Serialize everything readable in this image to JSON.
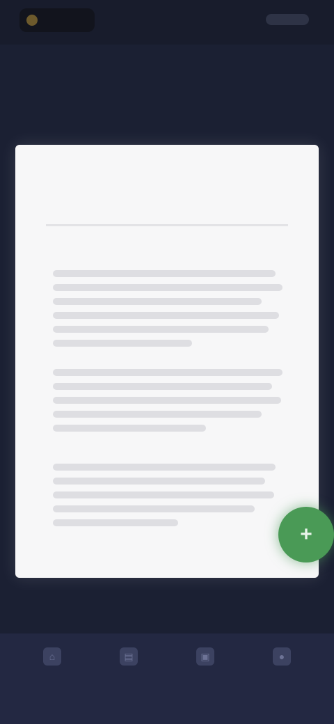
{
  "status_bar": {
    "brand_label": ""
  },
  "header": {
    "title": "",
    "subtitle": ""
  },
  "document": {
    "heading": "",
    "subheading": "",
    "sections": [
      {
        "label": "",
        "lines": 6
      },
      {
        "label": "",
        "lines": 5
      },
      {
        "label": "",
        "lines": 5
      }
    ]
  },
  "fab": {
    "icon": "plus-icon"
  },
  "footer": {
    "caption": ""
  },
  "tab_bar": {
    "items": [
      {
        "icon": "home-icon",
        "label": ""
      },
      {
        "icon": "document-icon",
        "label": ""
      },
      {
        "icon": "scan-icon",
        "label": ""
      },
      {
        "icon": "profile-icon",
        "label": ""
      }
    ]
  },
  "colors": {
    "background": "#1b2033",
    "card": "#f7f7f8",
    "accent": "#4a9a56",
    "tab_bar": "#232842"
  }
}
